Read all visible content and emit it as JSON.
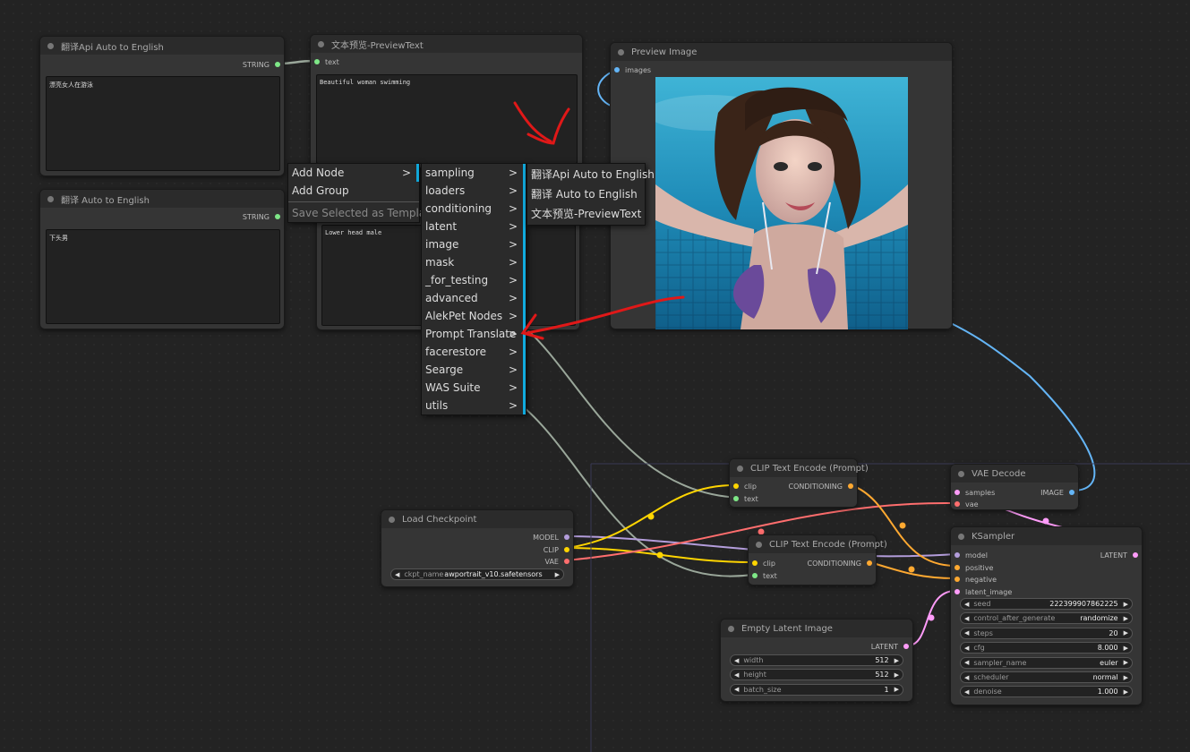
{
  "nodes": {
    "translate_api": {
      "title": "翻译Api  Auto to English",
      "output": "STRING",
      "text": "漂亮女人在游泳"
    },
    "translate": {
      "title": "翻译  Auto to English",
      "output": "STRING",
      "text": "下头男"
    },
    "preview_text": {
      "title": "文本预览-PreviewText",
      "input": "text",
      "text": "Beautiful woman swimming"
    },
    "preview_text_2": {
      "text": "Lower head male"
    },
    "preview_image": {
      "title": "Preview Image",
      "input": "images"
    },
    "clip_encode_1": {
      "title": "CLIP Text Encode (Prompt)",
      "inputs": [
        "clip",
        "text"
      ],
      "output": "CONDITIONING"
    },
    "clip_encode_2": {
      "title": "CLIP Text Encode (Prompt)",
      "inputs": [
        "clip",
        "text"
      ],
      "output": "CONDITIONING"
    },
    "vae_decode": {
      "title": "VAE Decode",
      "inputs": [
        "samples",
        "vae"
      ],
      "output": "IMAGE"
    },
    "load_checkpoint": {
      "title": "Load Checkpoint",
      "outputs": [
        "MODEL",
        "CLIP",
        "VAE"
      ],
      "widget_label": "ckpt_name",
      "widget_value": "awportrait_v10.safetensors"
    },
    "ksampler": {
      "title": "KSampler",
      "inputs": [
        "model",
        "positive",
        "negative",
        "latent_image"
      ],
      "output": "LATENT",
      "widgets": [
        {
          "label": "seed",
          "value": "222399907862225"
        },
        {
          "label": "control_after_generate",
          "value": "randomize"
        },
        {
          "label": "steps",
          "value": "20"
        },
        {
          "label": "cfg",
          "value": "8.000"
        },
        {
          "label": "sampler_name",
          "value": "euler"
        },
        {
          "label": "scheduler",
          "value": "normal"
        },
        {
          "label": "denoise",
          "value": "1.000"
        }
      ]
    },
    "empty_latent": {
      "title": "Empty Latent Image",
      "output": "LATENT",
      "widgets": [
        {
          "label": "width",
          "value": "512"
        },
        {
          "label": "height",
          "value": "512"
        },
        {
          "label": "batch_size",
          "value": "1"
        }
      ]
    }
  },
  "menu": {
    "main": [
      {
        "label": "Add Node",
        "submenu": true
      },
      {
        "label": "Add Group",
        "submenu": false
      },
      {
        "label": "Save Selected as Template",
        "submenu": false,
        "disabled": true
      }
    ],
    "categories": [
      "sampling",
      "loaders",
      "conditioning",
      "latent",
      "image",
      "mask",
      "_for_testing",
      "advanced",
      "AlekPet Nodes",
      "Prompt Translate",
      "facerestore",
      "Searge",
      "WAS Suite",
      "utils"
    ],
    "submenu_arrow": ">",
    "prompt_translate_items": [
      "翻译Api Auto to English",
      "翻译 Auto to English",
      "文本预览-PreviewText"
    ]
  },
  "colors": {
    "model": "#b39ddb",
    "clip": "#ffd500",
    "vae": "#ff6e6e",
    "conditioning": "#ffa931",
    "latent": "#ff9cf9",
    "image": "#64b5f6",
    "string": "#7ee787",
    "text_wire": "#9aa79a",
    "annotation": "#e01818"
  }
}
